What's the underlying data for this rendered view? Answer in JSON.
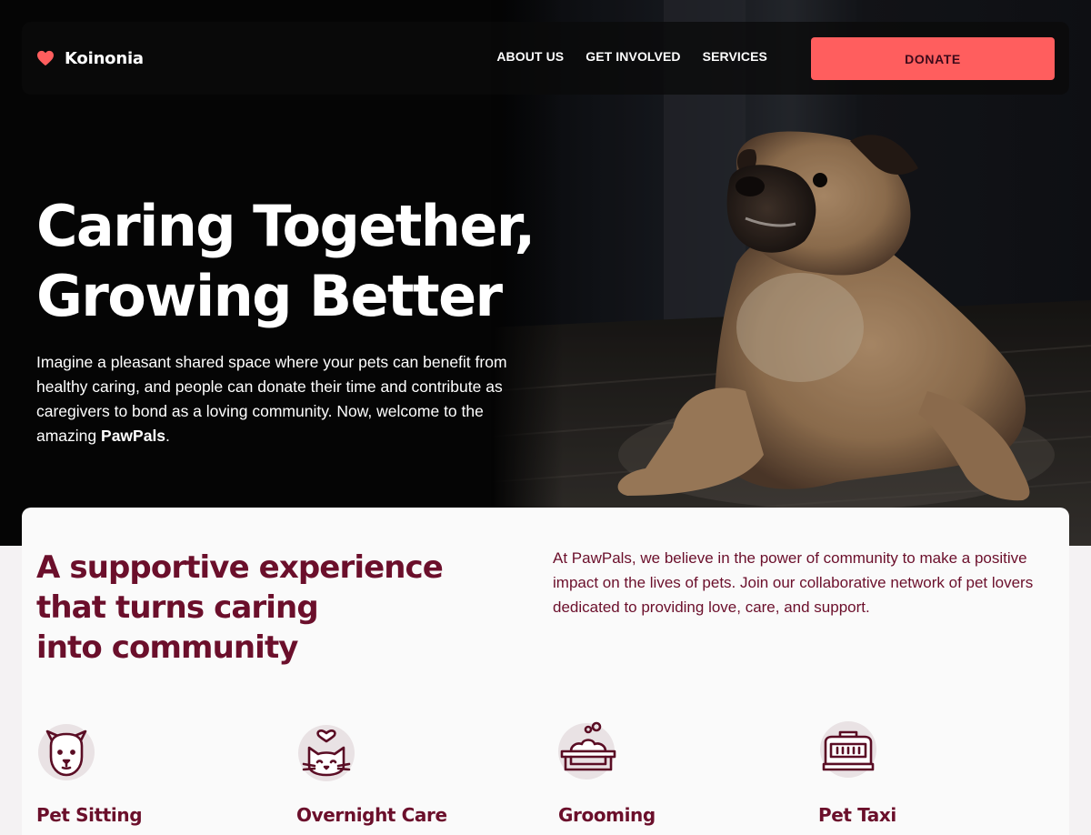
{
  "brand": {
    "name": "Koinonia",
    "icon": "heart-icon",
    "icon_color": "#ff5e5e"
  },
  "nav": {
    "links": [
      {
        "label": "ABOUT US"
      },
      {
        "label": "GET INVOLVED"
      },
      {
        "label": "SERVICES"
      }
    ],
    "donate_label": "DONATE"
  },
  "hero": {
    "title_line1": "Caring Together,",
    "title_line2": "Growing Better",
    "text_before": "Imagine a pleasant shared space where your pets can benefit from healthy caring, and people can donate their time and contribute as caregivers to bond as a loving community. Now, welcome to the amazing ",
    "text_bold": "PawPals",
    "text_after": ".",
    "image": "pug-photo"
  },
  "about": {
    "title_line1": "A supportive experience",
    "title_line2": "that turns caring",
    "title_line3": "into community",
    "description": "At PawPals, we believe in the power of community to make a positive impact on the lives of pets. Join our collaborative network of pet lovers dedicated to providing love, care, and support."
  },
  "services": [
    {
      "name": "Pet Sitting",
      "icon": "dog-face-icon"
    },
    {
      "name": "Overnight Care",
      "icon": "cat-heart-icon"
    },
    {
      "name": "Grooming",
      "icon": "pet-bath-icon"
    },
    {
      "name": "Pet Taxi",
      "icon": "pet-carrier-icon"
    }
  ],
  "colors": {
    "accent": "#ff5e5e",
    "primary_text": "#6b0f2b",
    "hero_bg": "#050505",
    "card_bg": "#fafafa"
  }
}
